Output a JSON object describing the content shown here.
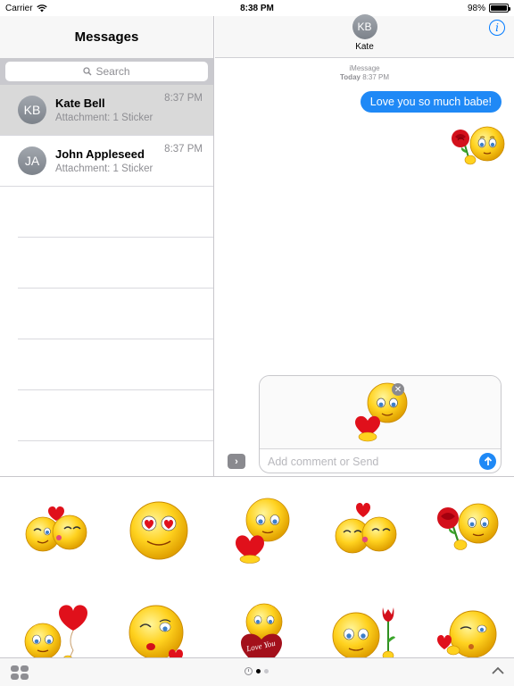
{
  "status_bar": {
    "carrier": "Carrier",
    "time": "8:38 PM",
    "battery": "98%",
    "battery_level": 0.98
  },
  "sidebar": {
    "title": "Messages",
    "search_placeholder": "Search",
    "conversations": [
      {
        "initials": "KB",
        "name": "Kate Bell",
        "preview": "Attachment: 1 Sticker",
        "time": "8:37 PM",
        "selected": true
      },
      {
        "initials": "JA",
        "name": "John Appleseed",
        "preview": "Attachment: 1 Sticker",
        "time": "8:37 PM",
        "selected": false
      }
    ]
  },
  "conversation": {
    "contact_initials": "KB",
    "contact_name": "Kate",
    "service": "iMessage",
    "day": "Today",
    "time": "8:37 PM",
    "message": "Love you so much babe!",
    "compose_placeholder": "Add comment or Send"
  },
  "stickers": [
    "wink-kiss-couple",
    "heart-eyes",
    "smiley-holding-heart",
    "kissing-couple",
    "smiley-with-rose",
    "smiley-with-heart-balloon",
    "lipstick-kiss-blowing",
    "love-you-heart",
    "smiley-with-tulip",
    "blowing-kiss-heart"
  ],
  "colors": {
    "accent": "#1f89f6",
    "emoji_yellow": "#ffd21f",
    "heart_red": "#e0101b"
  }
}
